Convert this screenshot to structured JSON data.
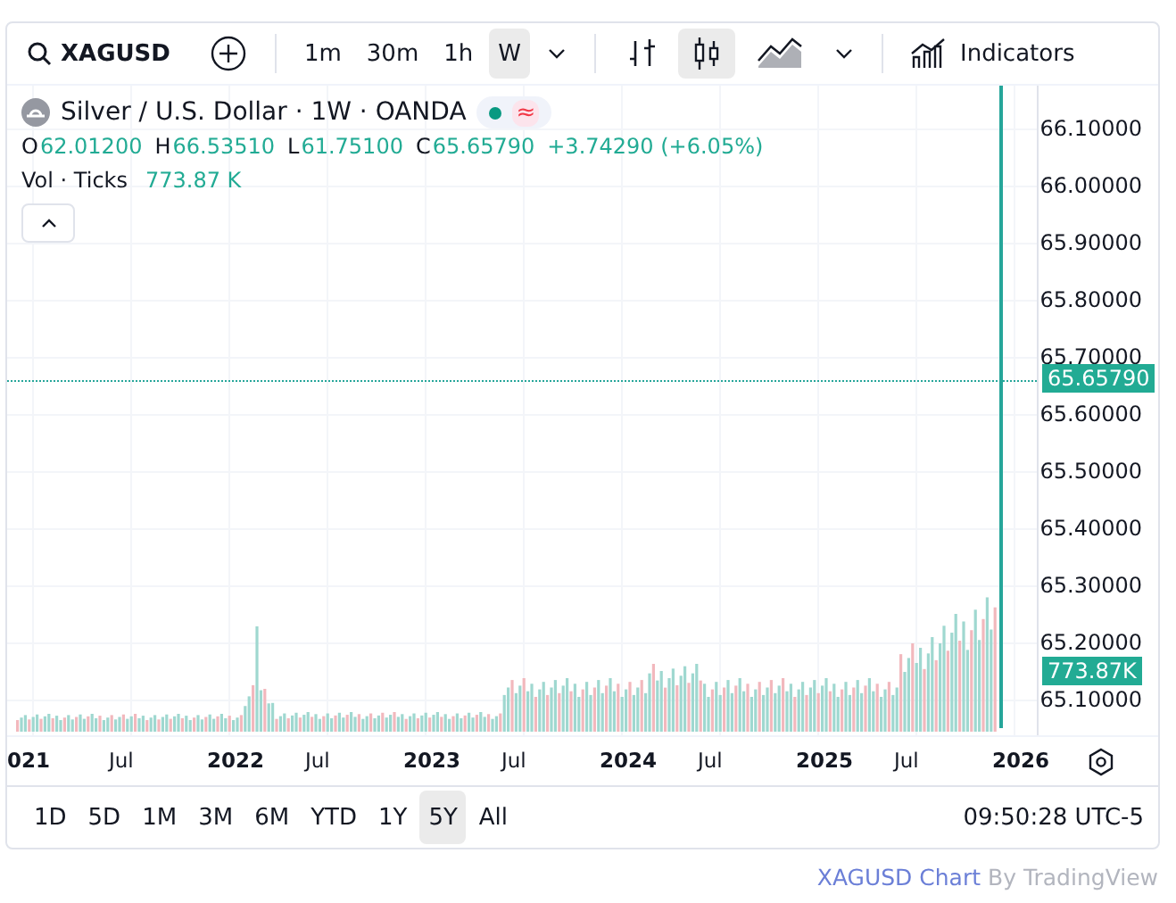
{
  "toolbar": {
    "symbol": "XAGUSD",
    "intervals": [
      {
        "label": "1m",
        "selected": false
      },
      {
        "label": "30m",
        "selected": false
      },
      {
        "label": "1h",
        "selected": false
      },
      {
        "label": "W",
        "selected": true
      }
    ],
    "chart_types": [
      {
        "kind": "bars",
        "selected": false
      },
      {
        "kind": "candles",
        "selected": true
      },
      {
        "kind": "area",
        "selected": false
      }
    ],
    "indicators_label": "Indicators"
  },
  "legend": {
    "title": "Silver / U.S. Dollar · 1W · OANDA",
    "status_glyph": "≈",
    "ohlc": [
      {
        "label": "O",
        "value": "62.01200"
      },
      {
        "label": "H",
        "value": "66.53510"
      },
      {
        "label": "L",
        "value": "61.75100"
      },
      {
        "label": "C",
        "value": "65.65790"
      }
    ],
    "change": "+3.74290 (+6.05%)",
    "volume_label": "Vol · Ticks",
    "volume_value": "773.87 K"
  },
  "price_axis": {
    "ticks": [
      "66.10000",
      "66.00000",
      "65.90000",
      "65.80000",
      "65.70000",
      "65.60000",
      "65.50000",
      "65.40000",
      "65.30000",
      "65.20000",
      "65.10000"
    ],
    "last_price": "65.65790",
    "volume_tag": "773.87K"
  },
  "time_axis": [
    {
      "label": "021",
      "kind": "year"
    },
    {
      "label": "Jul",
      "kind": "month"
    },
    {
      "label": "2022",
      "kind": "year"
    },
    {
      "label": "Jul",
      "kind": "month"
    },
    {
      "label": "2023",
      "kind": "year"
    },
    {
      "label": "Jul",
      "kind": "month"
    },
    {
      "label": "2024",
      "kind": "year"
    },
    {
      "label": "Jul",
      "kind": "month"
    },
    {
      "label": "2025",
      "kind": "year"
    },
    {
      "label": "Jul",
      "kind": "month"
    },
    {
      "label": "2026",
      "kind": "year"
    }
  ],
  "ranges": [
    {
      "label": "1D",
      "selected": false
    },
    {
      "label": "5D",
      "selected": false
    },
    {
      "label": "1M",
      "selected": false
    },
    {
      "label": "3M",
      "selected": false
    },
    {
      "label": "6M",
      "selected": false
    },
    {
      "label": "YTD",
      "selected": false
    },
    {
      "label": "1Y",
      "selected": false
    },
    {
      "label": "5Y",
      "selected": true
    },
    {
      "label": "All",
      "selected": false
    }
  ],
  "clock": "09:50:28 UTC-5",
  "footer": {
    "link": "XAGUSD Chart",
    "attribution": "By TradingView"
  }
}
